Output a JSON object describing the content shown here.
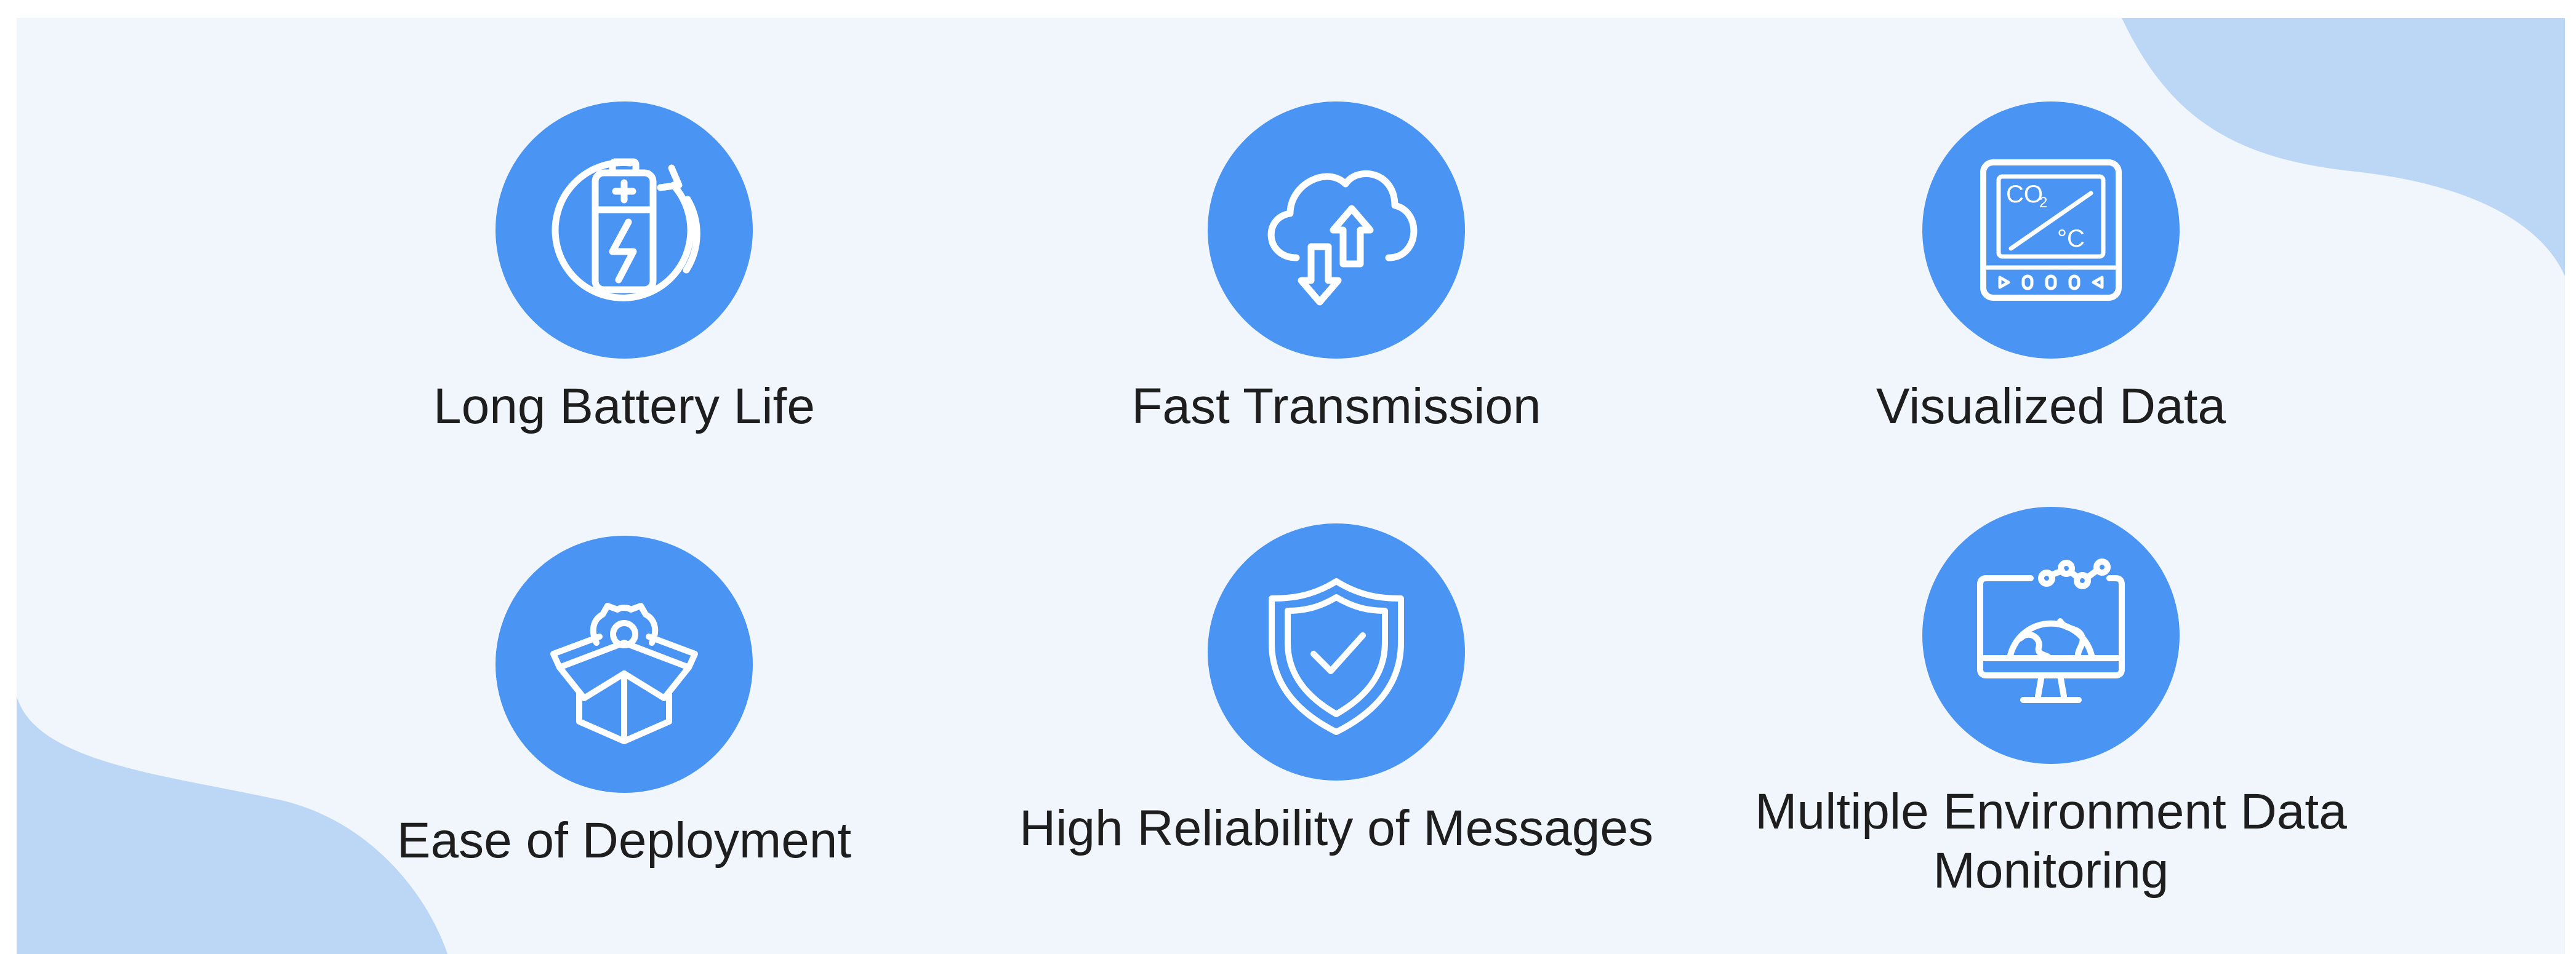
{
  "colors": {
    "accent": "#4a94f3",
    "panel_background": "#f1f6fd",
    "decor_blob": "#bcd7f6",
    "text": "#1e1e1e",
    "icon_stroke": "#ffffff"
  },
  "features": [
    {
      "label": "Long Battery Life",
      "icon": "battery-icon"
    },
    {
      "label": "Fast Transmission",
      "icon": "cloud-transfer-icon"
    },
    {
      "label": "Visualized Data",
      "icon": "co2-temperature-display-icon",
      "icon_text": {
        "co2": "CO",
        "co2_sub": "2",
        "temp": "°C"
      }
    },
    {
      "label": "Ease of Deployment",
      "icon": "box-gear-icon"
    },
    {
      "label": "High Reliability of Messages",
      "icon": "shield-check-icon"
    },
    {
      "label": "Multiple Environment Data Monitoring",
      "icon": "monitor-globe-icon"
    }
  ]
}
